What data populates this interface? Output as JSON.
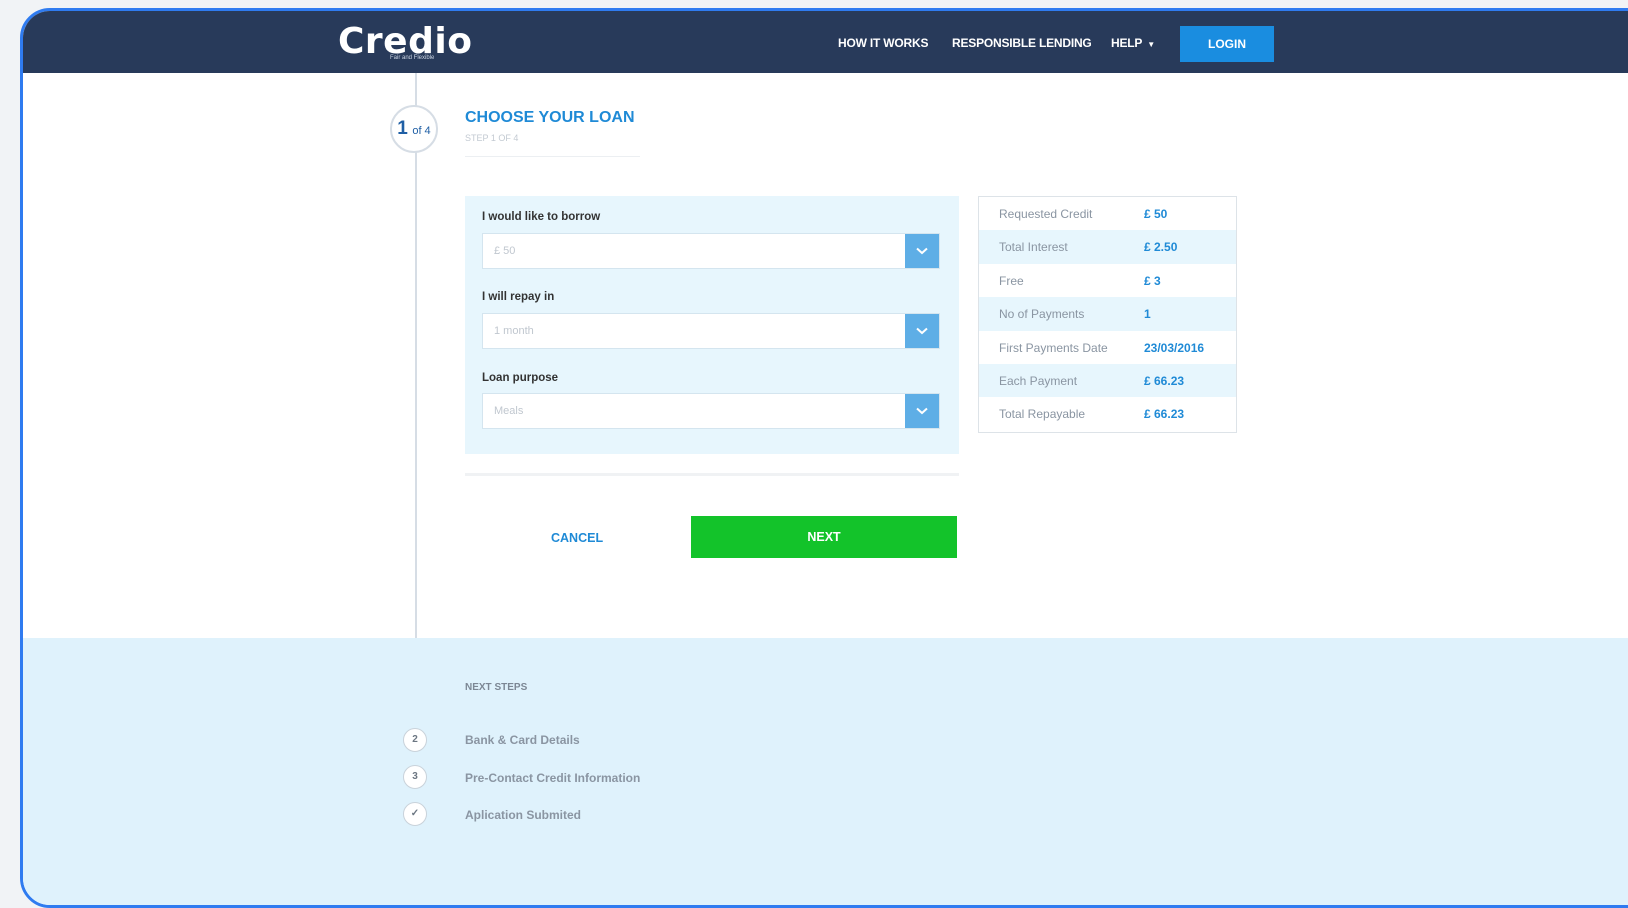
{
  "brand": {
    "name": "Credio",
    "tagline": "Fair and Flexible"
  },
  "nav": {
    "how_it_works": "HOW IT WORKS",
    "responsible_lending": "RESPONSIBLE LENDING",
    "help": "HELP",
    "login": "LOGIN"
  },
  "step": {
    "number": "1",
    "of": "of 4",
    "title": "CHOOSE YOUR LOAN",
    "subtitle": "STEP 1 OF 4"
  },
  "form": {
    "borrow_label": "I would like to borrow",
    "borrow_value": "£ 50",
    "repay_label": "I will repay in",
    "repay_value": "1 month",
    "purpose_label": "Loan purpose",
    "purpose_value": "Meals"
  },
  "summary": [
    {
      "label": "Requested Credit",
      "value": "£ 50"
    },
    {
      "label": "Total Interest",
      "value": "£ 2.50"
    },
    {
      "label": "Free",
      "value": "£ 3"
    },
    {
      "label": "No of Payments",
      "value": "1"
    },
    {
      "label": "First Payments Date",
      "value": "23/03/2016"
    },
    {
      "label": "Each Payment",
      "value": "£ 66.23"
    },
    {
      "label": "Total Repayable",
      "value": "£ 66.23"
    }
  ],
  "actions": {
    "cancel": "CANCEL",
    "next": "NEXT"
  },
  "next_steps": {
    "heading": "NEXT STEPS",
    "items": [
      {
        "marker": "2",
        "label": "Bank & Card Details"
      },
      {
        "marker": "3",
        "label": "Pre-Contact Credit Information"
      },
      {
        "marker": "✓",
        "label": "Aplication Submited"
      }
    ]
  },
  "colors": {
    "navbar": "#283a5a",
    "accent": "#1f8ad6",
    "next_button": "#13c32a",
    "panel": "#e7f6fd"
  }
}
